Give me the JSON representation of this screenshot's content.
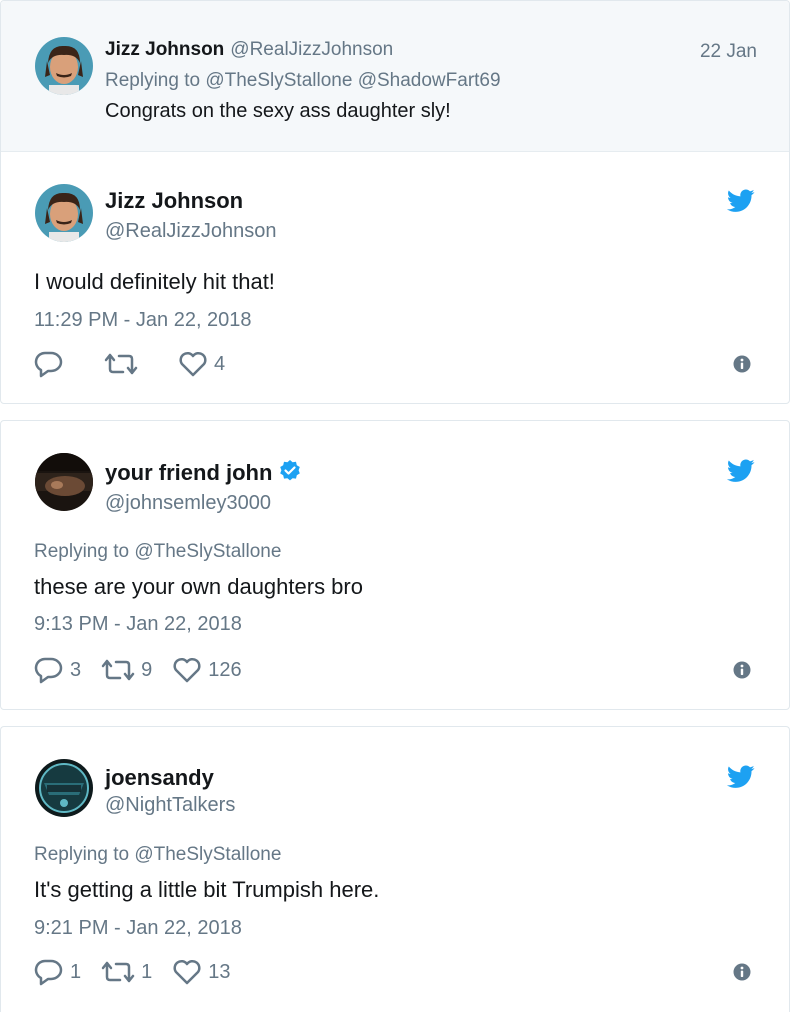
{
  "parent_tweet": {
    "name": "Jizz Johnson",
    "handle": "@RealJizzJohnson",
    "date": "22 Jan",
    "replying_to": "Replying to @TheSlyStallone @ShadowFart69",
    "text": "Congrats on the sexy ass daughter sly!"
  },
  "tweets": [
    {
      "name": "Jizz Johnson",
      "handle": "@RealJizzJohnson",
      "verified": false,
      "replying_to": "",
      "text": "I would definitely hit that!",
      "timestamp": "11:29 PM - Jan 22, 2018",
      "replies": "",
      "retweets": "",
      "likes": "4"
    },
    {
      "name": "your friend john",
      "handle": "@johnsemley3000",
      "verified": true,
      "replying_to": "Replying to @TheSlyStallone",
      "text": "these are your own daughters bro",
      "timestamp": "9:13 PM - Jan 22, 2018",
      "replies": "3",
      "retweets": "9",
      "likes": "126"
    },
    {
      "name": "joensandy",
      "handle": "@NightTalkers",
      "verified": false,
      "replying_to": "Replying to @TheSlyStallone",
      "text": "It's getting a little bit Trumpish here.",
      "timestamp": "9:21 PM - Jan 22, 2018",
      "replies": "1",
      "retweets": "1",
      "likes": "13"
    }
  ],
  "colors": {
    "twitter_blue": "#1da1f2",
    "verified_blue": "#1da1f2",
    "muted_text": "#657786",
    "border": "#e1e8ed",
    "context_bg": "#f5f8fa"
  },
  "icons": [
    "twitter-bird-icon",
    "reply-icon",
    "retweet-icon",
    "like-icon",
    "info-icon",
    "verified-badge-icon"
  ]
}
